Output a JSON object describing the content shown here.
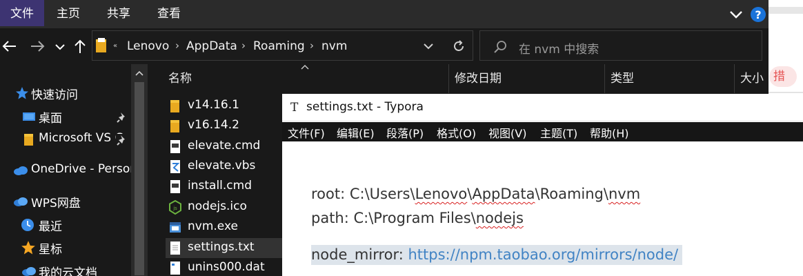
{
  "ribbon": {
    "tabs": [
      "文件",
      "主页",
      "共享",
      "查看"
    ]
  },
  "address": {
    "crumbs": [
      "Lenovo",
      "AppData",
      "Roaming",
      "nvm"
    ],
    "search_placeholder": "在 nvm 中搜索"
  },
  "nav": {
    "items": [
      {
        "label": "快速访问",
        "icon": "star-icon"
      },
      {
        "label": "桌面",
        "icon": "desktop-icon"
      },
      {
        "label": "Microsoft VS C",
        "icon": "folder-icon"
      },
      {
        "label": "OneDrive - Persor",
        "icon": "cloud-icon"
      },
      {
        "label": "WPS网盘",
        "icon": "cloud-icon"
      },
      {
        "label": "最近",
        "icon": "clock-icon"
      },
      {
        "label": "星标",
        "icon": "star-icon"
      },
      {
        "label": "我的云文档",
        "icon": "cloud-icon"
      }
    ]
  },
  "files": {
    "columns": [
      "名称",
      "修改日期",
      "类型",
      "大小"
    ],
    "items": [
      {
        "name": "v14.16.1",
        "icon": "folder-icon"
      },
      {
        "name": "v16.14.2",
        "icon": "folder-icon"
      },
      {
        "name": "elevate.cmd",
        "icon": "cmd-file-icon"
      },
      {
        "name": "elevate.vbs",
        "icon": "vbs-file-icon"
      },
      {
        "name": "install.cmd",
        "icon": "cmd-file-icon"
      },
      {
        "name": "nodejs.ico",
        "icon": "nodejs-icon"
      },
      {
        "name": "nvm.exe",
        "icon": "exe-file-icon"
      },
      {
        "name": "settings.txt",
        "icon": "text-file-icon",
        "selected": true
      },
      {
        "name": "unins000.dat",
        "icon": "dat-file-icon"
      }
    ]
  },
  "typora": {
    "title": "settings.txt - Typora",
    "menu": [
      "文件(F)",
      "编辑(E)",
      "段落(P)",
      "格式(O)",
      "视图(V)",
      "主题(T)",
      "帮助(H)"
    ],
    "root_prefix": "root: C:\\Users\\",
    "root_user": "Lenovo",
    "root_sep1": "\\",
    "root_appdata": "AppData",
    "root_mid": "\\Roaming\\",
    "root_nvm": "nvm",
    "path_prefix": "path: C:\\Program Files\\",
    "path_nodejs": "nodejs",
    "mirror_key": "node_mirror: ",
    "mirror_url": "https://npm.taobao.org/mirrors/node/"
  },
  "background_app": {
    "badge_text": "措"
  },
  "colors": {
    "accent_file_tab": "#3d3472",
    "link": "#4183c4",
    "selection_highlight": "#dde4eb"
  }
}
